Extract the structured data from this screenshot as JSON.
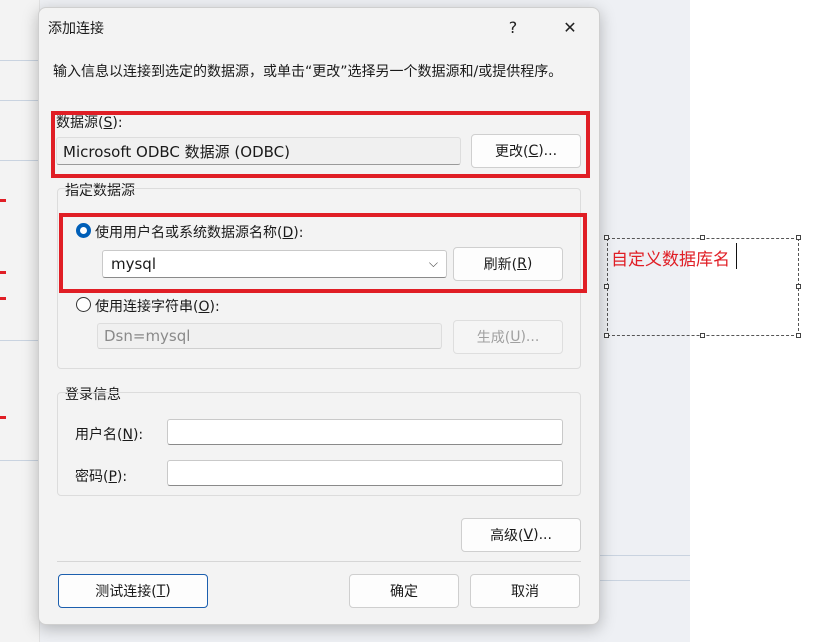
{
  "dialog": {
    "title": "添加连接",
    "help_glyph": "?",
    "close_glyph": "✕",
    "description": "输入信息以连接到选定的数据源，或单击“更改”选择另一个数据源和/或提供程序。"
  },
  "datasource": {
    "label_prefix": "数据源(",
    "label_key": "S",
    "label_suffix": "):",
    "value": "Microsoft ODBC 数据源 (ODBC)",
    "change_prefix": "更改(",
    "change_key": "C",
    "change_suffix": ")..."
  },
  "specify": {
    "group_title": "指定数据源",
    "option1_prefix": "使用用户名或系统数据源名称(",
    "option1_key": "D",
    "option1_suffix": "):",
    "dsn_value": "mysql",
    "refresh_prefix": "刷新(",
    "refresh_key": "R",
    "refresh_suffix": ")",
    "option2_prefix": "使用连接字符串(",
    "option2_key": "O",
    "option2_suffix": "):",
    "connstr_value": "Dsn=mysql",
    "build_prefix": "生成(",
    "build_key": "U",
    "build_suffix": ")..."
  },
  "login": {
    "group_title": "登录信息",
    "username_prefix": "用户名(",
    "username_key": "N",
    "username_suffix": "):",
    "username_value": "",
    "password_prefix": "密码(",
    "password_key": "P",
    "password_suffix": "):",
    "password_value": ""
  },
  "buttons": {
    "advanced_prefix": "高级(",
    "advanced_key": "V",
    "advanced_suffix": ")...",
    "test_prefix": "测试连接(",
    "test_key": "T",
    "test_suffix": ")",
    "ok": "确定",
    "cancel": "取消"
  },
  "annotation": {
    "text": "自定义数据库名"
  },
  "colors": {
    "highlight": "#e01e25",
    "accent": "#005fb8"
  }
}
